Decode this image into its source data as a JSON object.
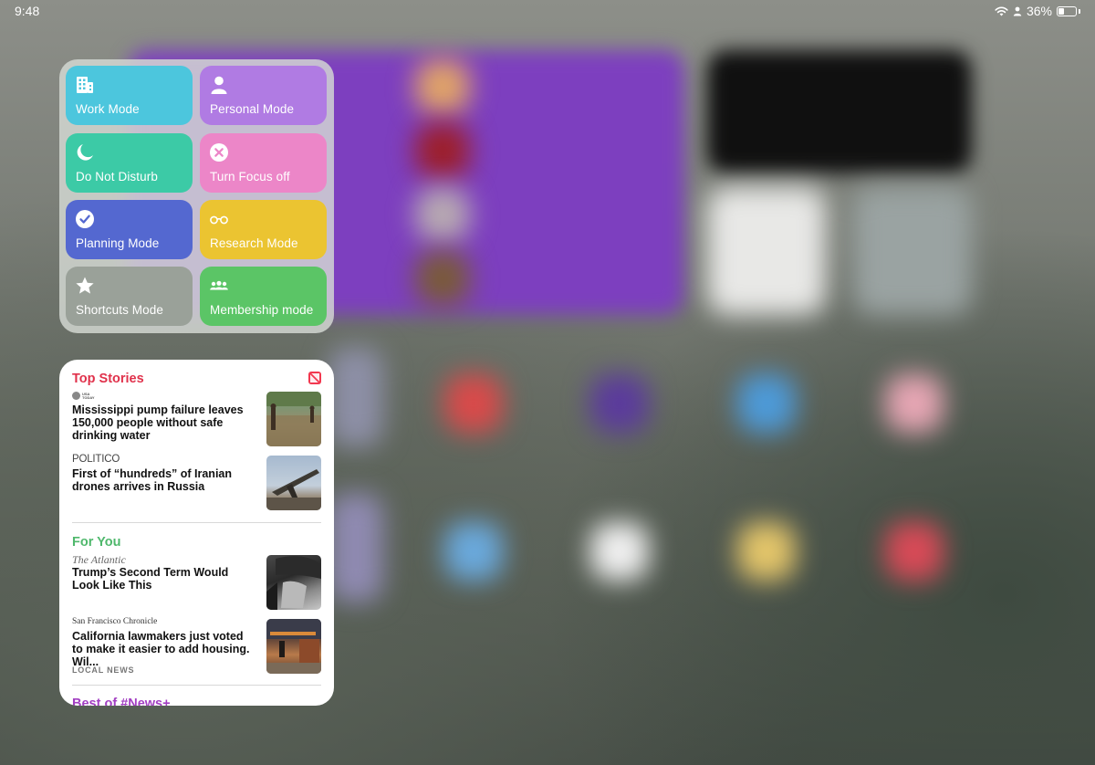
{
  "status_bar": {
    "time": "9:48",
    "battery_percent": "36%",
    "battery_level": 0.36
  },
  "shortcuts_widget": {
    "tiles": [
      {
        "label": "Work Mode",
        "icon": "building-icon",
        "color": "#4cc6dd"
      },
      {
        "label": "Personal Mode",
        "icon": "person-icon",
        "color": "#b07be3"
      },
      {
        "label": "Do Not Disturb",
        "icon": "moon-icon",
        "color": "#3ccaa6"
      },
      {
        "label": "Turn Focus off",
        "icon": "x-circle-icon",
        "color": "#ec86c8"
      },
      {
        "label": "Planning Mode",
        "icon": "checkmark-circle-icon",
        "color": "#5468d0"
      },
      {
        "label": "Research Mode",
        "icon": "glasses-icon",
        "color": "#ebc431"
      },
      {
        "label": "Shortcuts Mode",
        "icon": "star-icon",
        "color": "#9aa199"
      },
      {
        "label": "Membership mode",
        "icon": "people-icon",
        "color": "#5bc566"
      }
    ]
  },
  "news_widget": {
    "top_stories": {
      "title": "Top Stories",
      "color": "#e0314b",
      "items": [
        {
          "publisher": "USA TODAY",
          "headline": "Mississippi pump failure leaves 150,000 people without safe drinking water"
        },
        {
          "publisher": "POLITICO",
          "headline": "First of “hundreds” of Iranian drones arrives in Russia"
        }
      ]
    },
    "for_you": {
      "title": "For You",
      "color": "#4fb86c",
      "items": [
        {
          "publisher": "The Atlantic",
          "headline": "Trump’s Second Term Would Look Like This"
        },
        {
          "publisher": "San Francisco Chronicle",
          "headline": "California lawmakers just voted to make it easier to add housing. Wil...",
          "tag": "LOCAL NEWS"
        }
      ]
    },
    "next_section": {
      "title": "Best of #News+",
      "color": "#a23fc2"
    }
  }
}
